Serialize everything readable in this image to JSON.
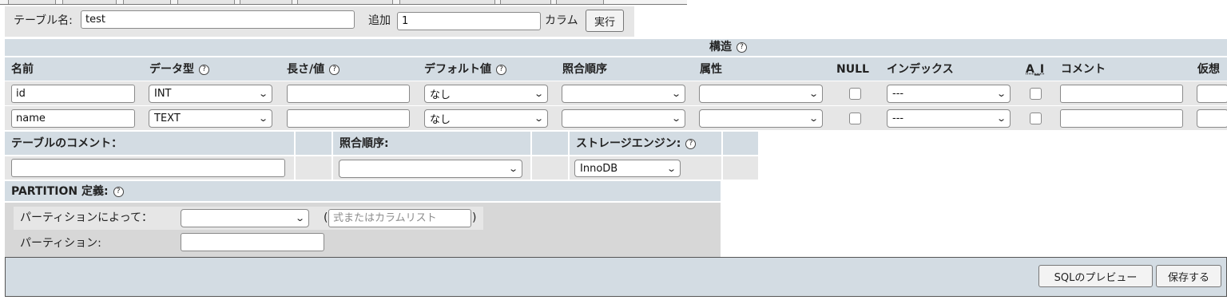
{
  "top": {
    "table_name_label": "テーブル名:",
    "table_name_value": "test",
    "add_label": "追加",
    "add_count": "1",
    "column_label": "カラム",
    "run_button": "実行"
  },
  "structure": {
    "title": "構造",
    "headers": {
      "name": "名前",
      "type": "データ型",
      "length": "長さ/値",
      "default": "デフォルト値",
      "collation": "照合順序",
      "attributes": "属性",
      "null": "NULL",
      "index": "インデックス",
      "ai": "A_I",
      "comment": "コメント",
      "virtual": "仮想"
    },
    "rows": [
      {
        "name": "id",
        "type": "INT",
        "length": "",
        "default": "なし",
        "collation": "",
        "attribute": "",
        "index": "---",
        "comment": ""
      },
      {
        "name": "name",
        "type": "TEXT",
        "length": "",
        "default": "なし",
        "collation": "",
        "attribute": "",
        "index": "---",
        "comment": ""
      }
    ]
  },
  "table_options": {
    "comment_label": "テーブルのコメント：",
    "comment_value": "",
    "collation_label": "照合順序:",
    "collation_value": "",
    "engine_label": "ストレージエンジン:",
    "engine_value": "InnoDB"
  },
  "partition": {
    "title": "PARTITION 定義:",
    "by_label": "パーティションによって：",
    "by_value": "",
    "paren_open": "(",
    "expr_placeholder": "式またはカラムリスト",
    "paren_close": ")",
    "partitions_label": "パーティション:",
    "partitions_value": ""
  },
  "actions": {
    "preview_sql": "SQLのプレビュー",
    "save": "保存する"
  },
  "help_icon": "?"
}
